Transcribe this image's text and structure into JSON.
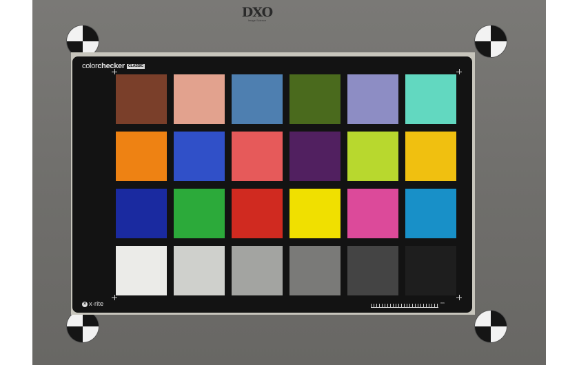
{
  "header": {
    "logo_text": "DXO",
    "logo_subtext": "Image Science"
  },
  "chart_card": {
    "brand_prefix": "color",
    "brand_bold": "checker",
    "edition_badge": "CLASSIC",
    "maker": "x·rite",
    "ruler_label": "mm"
  },
  "patches": [
    {
      "name": "dark-skin",
      "color": "#7a3f2a"
    },
    {
      "name": "light-skin",
      "color": "#e2a28e"
    },
    {
      "name": "blue-sky",
      "color": "#4e7fb0"
    },
    {
      "name": "foliage",
      "color": "#4a6a1d"
    },
    {
      "name": "blue-flower",
      "color": "#8d8dc4"
    },
    {
      "name": "bluish-green",
      "color": "#62d8c0"
    },
    {
      "name": "orange",
      "color": "#ee8213"
    },
    {
      "name": "purplish-blue",
      "color": "#3050c8"
    },
    {
      "name": "moderate-red",
      "color": "#e65a5a"
    },
    {
      "name": "purple",
      "color": "#512060"
    },
    {
      "name": "yellow-green",
      "color": "#b8d82e"
    },
    {
      "name": "orange-yellow",
      "color": "#f0c010"
    },
    {
      "name": "blue",
      "color": "#1a2aa0"
    },
    {
      "name": "green",
      "color": "#2caa3a"
    },
    {
      "name": "red",
      "color": "#d02a20"
    },
    {
      "name": "yellow",
      "color": "#f0e000"
    },
    {
      "name": "magenta",
      "color": "#dc4a9a"
    },
    {
      "name": "cyan",
      "color": "#1890c8"
    },
    {
      "name": "white",
      "color": "#ebebe8"
    },
    {
      "name": "neutral-8",
      "color": "#cfd0cc"
    },
    {
      "name": "neutral-6-5",
      "color": "#a3a4a1"
    },
    {
      "name": "neutral-5",
      "color": "#7a7a78"
    },
    {
      "name": "neutral-3-5",
      "color": "#444444"
    },
    {
      "name": "black",
      "color": "#1e1e1e"
    }
  ]
}
